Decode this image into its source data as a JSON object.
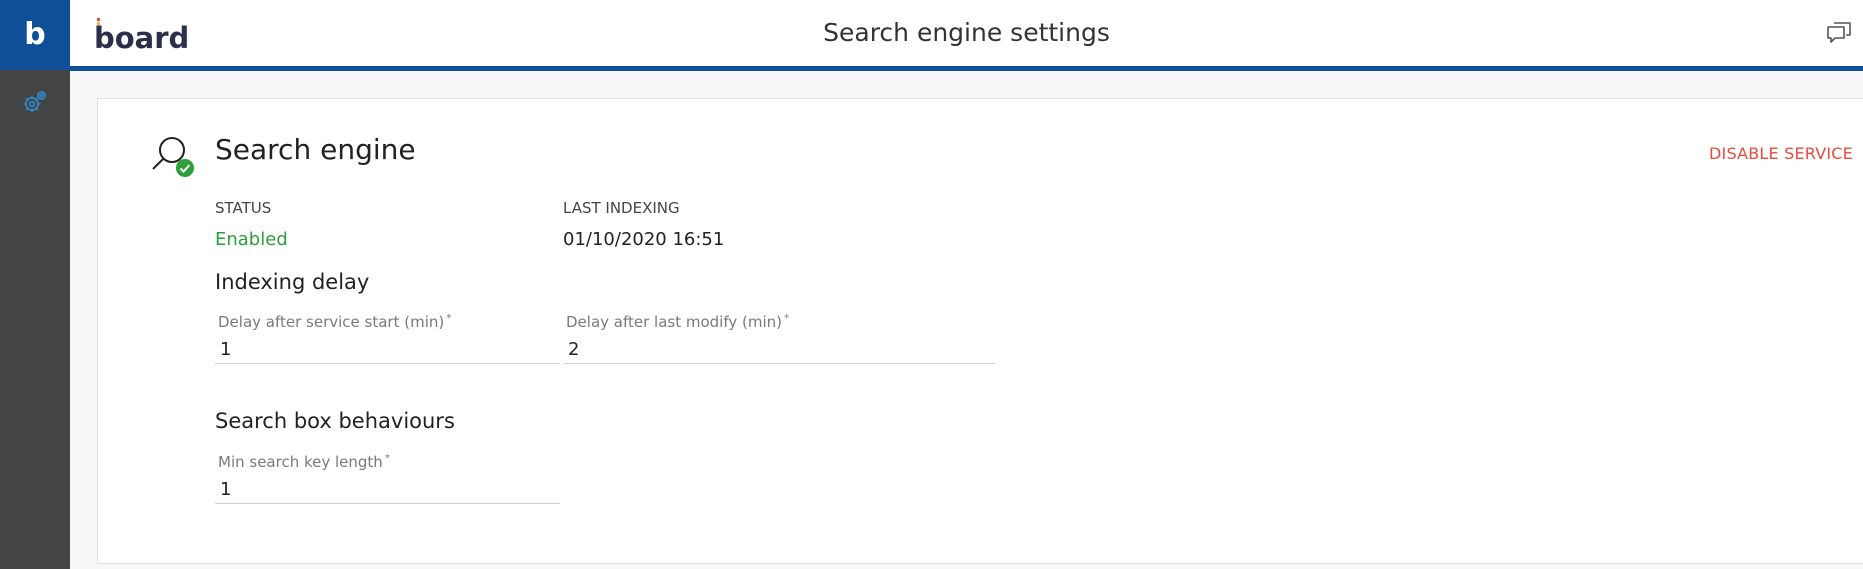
{
  "rail": {
    "logo_letter": "b"
  },
  "header": {
    "brand": "board",
    "title": "Search engine settings"
  },
  "section": {
    "title": "Search engine",
    "disable_label": "DISABLE SERVICE"
  },
  "status": {
    "label": "STATUS",
    "value": "Enabled"
  },
  "last_indexing": {
    "label": "LAST INDEXING",
    "value": "01/10/2020 16:51"
  },
  "indexing_delay": {
    "heading": "Indexing delay",
    "service_start": {
      "label": "Delay after service start (min)",
      "required_mark": "*",
      "value": "1"
    },
    "last_modify": {
      "label": "Delay after last modify (min)",
      "required_mark": "*",
      "value": "2"
    }
  },
  "search_box": {
    "heading": "Search box behaviours",
    "min_key_length": {
      "label": "Min search key length",
      "required_mark": "*",
      "value": "1"
    }
  },
  "colors": {
    "brand_blue": "#0e4f97",
    "rail_dark": "#444444",
    "enabled_green": "#2e9f3a",
    "danger_red": "#e64a3c"
  },
  "icons": [
    "settings-gear-icon",
    "chat-icon",
    "search-icon",
    "check-circle-icon"
  ]
}
